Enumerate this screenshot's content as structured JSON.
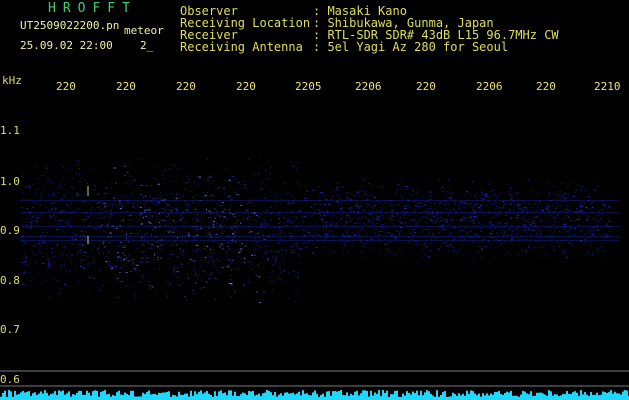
{
  "app_title": "HROFFT",
  "file": {
    "name": "UT2509022200.pn",
    "tag": "meteor",
    "datetime": "25.09.02 22:00",
    "extra": "2_"
  },
  "header": [
    {
      "label": "Observer",
      "value": ": Masaki Kano"
    },
    {
      "label": "Receiving Location",
      "value": ": Shibukawa, Gunma, Japan"
    },
    {
      "label": "Receiver",
      "value": ": RTL-SDR SDR# 43dB L15 96.7MHz CW"
    },
    {
      "label": "Receiving Antenna",
      "value": ": 5el Yagi Az 280 for Seoul"
    }
  ],
  "unit_label": "kHz",
  "x_ticks": [
    "220",
    "220",
    "220",
    "220",
    "2205",
    "2206",
    "220",
    "2206",
    "220",
    "2210"
  ],
  "y_ticks": [
    "1.1",
    "1.0",
    "0.9",
    "0.8",
    "0.7",
    "0.6"
  ],
  "colors": {
    "background": "#000000",
    "signal": "#1a2fd8",
    "bright": "#6f88ff",
    "baseline": "#20d8ff",
    "grid_line": "#7a7a7a"
  }
}
